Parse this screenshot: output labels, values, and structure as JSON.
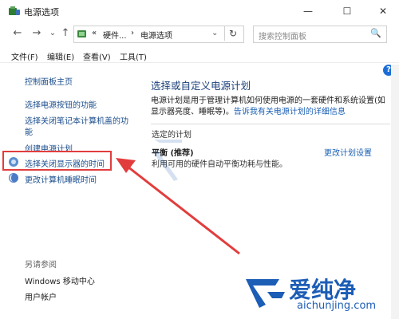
{
  "window": {
    "title": "电源选项",
    "minimize_glyph": "—",
    "maximize_glyph": "☐",
    "close_glyph": "✕"
  },
  "nav": {
    "back_glyph": "←",
    "forward_glyph": "→",
    "recent_glyph": "⌄",
    "up_glyph": "↑",
    "breadcrumb_overflow": "«",
    "breadcrumb_1": "硬件...",
    "breadcrumb_sep": "›",
    "breadcrumb_2": "电源选项",
    "dropdown_glyph": "⌄",
    "refresh_glyph": "↻"
  },
  "search": {
    "placeholder": "搜索控制面板",
    "icon": "search-icon"
  },
  "menu": {
    "file": "文件(F)",
    "edit": "编辑(E)",
    "view": "查看(V)",
    "tools": "工具(T)"
  },
  "sidebar": {
    "home": "控制面板主页",
    "items": [
      "选择电源按钮的功能",
      "选择关闭笔记本计算机盖的功",
      "能",
      "创建电源计划",
      "选择关闭显示器的时间",
      "更改计算机睡眠时间"
    ],
    "see_also_title": "另请参阅",
    "see_also": [
      "Windows 移动中心",
      "用户帐户"
    ]
  },
  "main": {
    "title": "选择或自定义电源计划",
    "description_line1": "电源计划是用于管理计算机如何使用电源的一套硬件和系统设置(如",
    "description_line2_prefix": "显示器亮度、睡眠等)。",
    "description_link": "告诉我有关电源计划的详细信息",
    "section_label": "选定的计划",
    "plan_name": "平衡 (推荐)",
    "plan_description": "利用可用的硬件自动平衡功耗与性能。",
    "plan_settings_link": "更改计划设置"
  },
  "help": {
    "glyph": "?"
  },
  "watermark": {
    "text": "爱纯净",
    "url": "aichunjing.com"
  },
  "colors": {
    "highlight": "#e23d3d",
    "link": "#1a5fb4",
    "title_blue": "#1a3f7a",
    "watermark": "#1c5db6"
  }
}
